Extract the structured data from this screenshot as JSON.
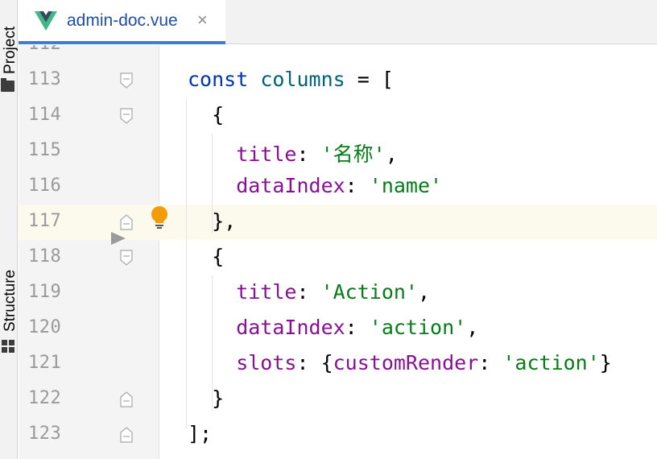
{
  "sidebar": {
    "project_label": "Project",
    "structure_label": "Structure"
  },
  "tab": {
    "filename": "admin-doc.vue",
    "close_glyph": "×",
    "vue_logo_colors": [
      "#41b883",
      "#34495e"
    ],
    "active_underline": "#3d7dd8"
  },
  "editor": {
    "partial_top_line_number": "112",
    "current_line": "117",
    "lines": [
      {
        "n": "113",
        "tokens": [
          [
            "kw",
            "const "
          ],
          [
            "var",
            "columns"
          ],
          [
            "",
            " = ["
          ]
        ]
      },
      {
        "n": "114",
        "tokens": [
          [
            "",
            "  {"
          ]
        ]
      },
      {
        "n": "115",
        "tokens": [
          [
            "prop",
            "    title"
          ],
          [
            "",
            ": "
          ],
          [
            "str",
            "'名称'"
          ],
          [
            "",
            ","
          ]
        ]
      },
      {
        "n": "116",
        "tokens": [
          [
            "prop",
            "    dataIndex"
          ],
          [
            "",
            ": "
          ],
          [
            "str",
            "'name'"
          ]
        ]
      },
      {
        "n": "117",
        "tokens": [
          [
            "",
            "  },"
          ]
        ]
      },
      {
        "n": "118",
        "tokens": [
          [
            "",
            "  {"
          ]
        ]
      },
      {
        "n": "119",
        "tokens": [
          [
            "prop",
            "    title"
          ],
          [
            "",
            ": "
          ],
          [
            "str",
            "'Action'"
          ],
          [
            "",
            ","
          ]
        ]
      },
      {
        "n": "120",
        "tokens": [
          [
            "prop",
            "    dataIndex"
          ],
          [
            "",
            ": "
          ],
          [
            "str",
            "'action'"
          ],
          [
            "",
            ","
          ]
        ]
      },
      {
        "n": "121",
        "tokens": [
          [
            "prop",
            "    slots"
          ],
          [
            "",
            ": {"
          ],
          [
            "prop",
            "customRender"
          ],
          [
            "",
            ": "
          ],
          [
            "str",
            "'action'"
          ],
          [
            "",
            "}"
          ]
        ]
      },
      {
        "n": "122",
        "tokens": [
          [
            "",
            "  }"
          ]
        ]
      },
      {
        "n": "123",
        "tokens": [
          [
            "",
            "];"
          ]
        ]
      }
    ],
    "fold_markers": {
      "113": "open",
      "114": "open",
      "117": "close",
      "118": "open",
      "122": "close",
      "123": "close"
    },
    "intention_icon": "lightbulb-icon",
    "colors": {
      "keyword": "#0033b3",
      "identifier": "#00627a",
      "property": "#871094",
      "string": "#067d17",
      "current_line_bg": "#fcfaed",
      "bulb": "#f49b0b"
    }
  }
}
